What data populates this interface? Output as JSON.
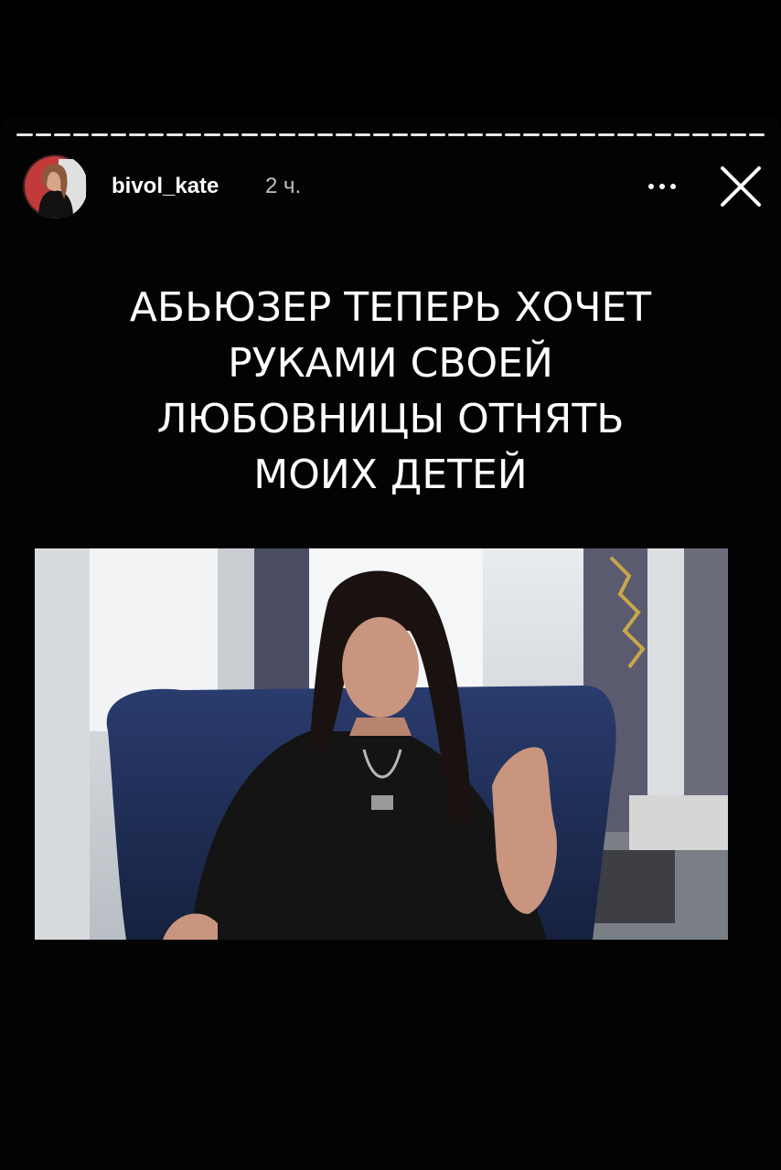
{
  "story": {
    "username": "bivol_kate",
    "timestamp": "2 ч.",
    "segments_total": 40,
    "segments_viewed": 40
  },
  "icons": {
    "more": "more-horizontal-icon",
    "close": "close-icon"
  },
  "caption": {
    "lines": [
      "АБЬЮЗЕР ТЕПЕРЬ ХОЧЕТ",
      "РУКАМИ СВОЕЙ",
      "ЛЮБОВНИЦЫ ОТНЯТЬ",
      "МОИХ ДЕТЕЙ"
    ]
  },
  "colors": {
    "background": "#000000",
    "chair": "#1f2f5c",
    "text": "#ffffff"
  }
}
